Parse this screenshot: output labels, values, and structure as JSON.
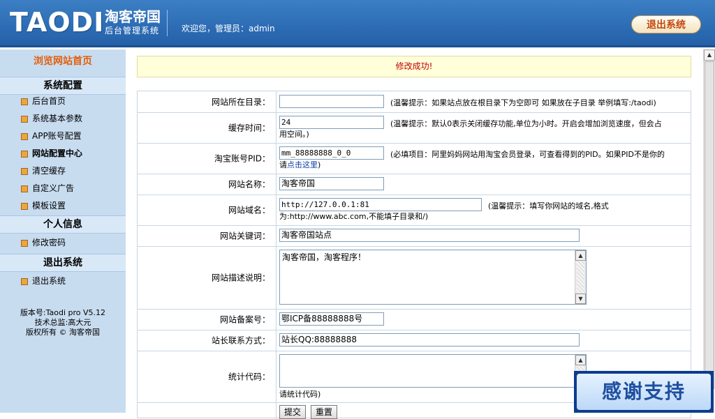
{
  "header": {
    "logo_text": "TAODI",
    "logo_cn": "淘客帝国",
    "logo_sub": "后台管理系统",
    "welcome": "欢迎您，管理员：admin",
    "logout_label": "退出系统"
  },
  "sidebar": {
    "home_link": "浏览网站首页",
    "sections": [
      {
        "title": "系统配置",
        "items": [
          "后台首页",
          "系统基本参数",
          "APP账号配置",
          "网站配置中心",
          "清空缓存",
          "自定义广告",
          "模板设置"
        ]
      },
      {
        "title": "个人信息",
        "items": [
          "修改密码"
        ]
      },
      {
        "title": "退出系统",
        "items": [
          "退出系统"
        ]
      }
    ],
    "info": {
      "version": "版本号:Taodi pro V5.12",
      "tech": "技术总监:高大元",
      "copyright": "版权所有 © 淘客帝国"
    }
  },
  "notice": "修改成功!",
  "form": {
    "dir_label": "网站所在目录：",
    "dir_value": "",
    "dir_hint": "(温馨提示：如果站点放在根目录下为空即可 如果放在子目录 举例填写:/taodi)",
    "cache_label": "缓存时间：",
    "cache_value": "24",
    "cache_hint_1": "(温馨提示：默认0表示关闭缓存功能,单位为小时。开启会增加浏览速度，但会占",
    "cache_hint_2": "用空间。)",
    "pid_label": "淘宝账号PID：",
    "pid_value": "mm_88888888_0_0",
    "pid_hint_1": "(必填项目：阿里妈妈网站用淘宝会员登录，可查看得到的PID。如果PID不是你的",
    "pid_hint_2a": "请",
    "pid_hint_link": "点击这里",
    "pid_hint_2b": ")",
    "name_label": "网站名称：",
    "name_value": "淘客帝国",
    "domain_label": "网站域名：",
    "domain_value": "http://127.0.0.1:81",
    "domain_hint_1": "(温馨提示：填写你网站的域名,格式",
    "domain_hint_2": "为:http://www.abc.com,不能填子目录和/)",
    "keywords_label": "网站关键词：",
    "keywords_value": "淘客帝国站点",
    "desc_label": "网站描述说明：",
    "desc_value": "淘客帝国，淘客程序！",
    "icp_label": "网站备案号：",
    "icp_value": "鄂ICP备88888888号",
    "contact_label": "站长联系方式：",
    "contact_value": "站长QQ:88888888",
    "stats_label": "统计代码：",
    "stats_value": "",
    "stats_hint": "请统计代码)",
    "submit_label": "提交",
    "reset_label": "重置"
  },
  "badge": {
    "text": "感谢支持"
  },
  "scroll": {
    "up_arrow": "▲",
    "down_arrow": "▼"
  }
}
